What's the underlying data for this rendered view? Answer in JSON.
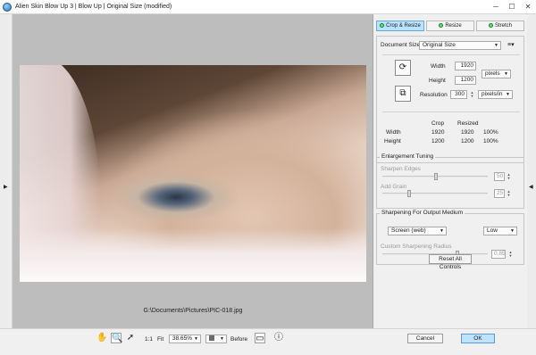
{
  "window": {
    "title": "Alien Skin Blow Up 3 | Blow Up | Original Size (modified)",
    "minimize": "─",
    "maximize": "☐",
    "close": "✕"
  },
  "preview": {
    "file_path": "G:\\Documents\\Pictures\\PIC-018.jpg"
  },
  "tabs": [
    {
      "label": "Crop & Resize",
      "active": true
    },
    {
      "label": "Resize",
      "active": false
    },
    {
      "label": "Stretch",
      "active": false
    }
  ],
  "crop_resize": {
    "document_size_label": "Document Size",
    "document_size_value": "Original Size",
    "width_label": "Width",
    "width_value": "1920",
    "height_label": "Height",
    "height_value": "1200",
    "units_value": "pixels",
    "resolution_label": "Resolution",
    "resolution_value": "300",
    "resolution_units_value": "pixels/in",
    "table": {
      "headers": [
        "Crop",
        "Resized"
      ],
      "rows": [
        {
          "label": "Width",
          "crop": "1920",
          "resized": "1920",
          "percent": "100%"
        },
        {
          "label": "Height",
          "crop": "1200",
          "resized": "1200",
          "percent": "100%"
        }
      ]
    }
  },
  "enlargement": {
    "title": "Enlargement Tuning",
    "sharpen_label": "Sharpen Edges",
    "sharpen_value": "50",
    "add_grain_label": "Add Grain",
    "add_grain_value": "25"
  },
  "sharpening": {
    "title": "Sharpening For Output Medium",
    "medium_value": "Screen (web)",
    "amount_value": "Low",
    "radius_label": "Custom Sharpening Radius",
    "radius_value": "0,85"
  },
  "reset_label": "Reset All Controls",
  "toolbar": {
    "ratio_label": "1:1",
    "fit_label": "Fit",
    "zoom_value": "38.65%",
    "before_label": "Before"
  },
  "buttons": {
    "cancel_label": "Cancel",
    "ok_label": "OK"
  }
}
